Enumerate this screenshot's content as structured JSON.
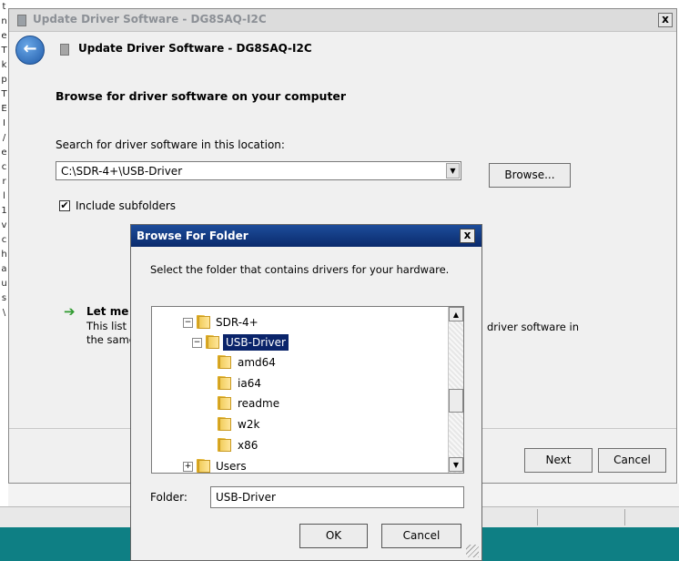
{
  "left_edge_chars": [
    "t",
    "n",
    "e",
    "T",
    "k",
    "p",
    "T",
    "E",
    "I",
    "/",
    "e",
    "c",
    "r",
    "l",
    "1",
    "",
    "v",
    "c",
    "h",
    "a",
    "u",
    "s",
    "\\"
  ],
  "wizard": {
    "title": "Update Driver Software - DG8SAQ-I2C",
    "close": "x",
    "back_arrow": "←",
    "header_title": "Update Driver Software - DG8SAQ-I2C",
    "heading": "Browse for driver software on your computer",
    "search_label": "Search for driver software in this location:",
    "path_value": "C:\\SDR-4+\\USB-Driver",
    "combo_arrow": "▼",
    "browse_label": "Browse...",
    "include_checked": "✔",
    "include_label": "Include subfolders",
    "let_me_arrow": "➔",
    "let_me_label": "Let me",
    "desc_line1": "This list v",
    "desc_line2": "the same",
    "desc_fragment": "driver software in",
    "next_label": "Next",
    "cancel_label": "Cancel"
  },
  "dialog": {
    "title": "Browse For Folder",
    "close": "x",
    "instruction": "Select the folder that contains drivers for your hardware.",
    "tree": {
      "items": [
        {
          "label": "SDR-4+",
          "expander": "−"
        },
        {
          "label": "USB-Driver",
          "expander": "−"
        },
        {
          "label": "amd64"
        },
        {
          "label": "ia64"
        },
        {
          "label": "readme"
        },
        {
          "label": "w2k"
        },
        {
          "label": "x86"
        },
        {
          "label": "Users",
          "expander": "+"
        }
      ],
      "scroll_up": "▲",
      "scroll_down": "▼"
    },
    "folder_label": "Folder:",
    "folder_value": "USB-Driver",
    "ok_label": "OK",
    "cancel_label": "Cancel"
  },
  "colors": {
    "dialog_title_bg": "#0a246a",
    "taskbar": "#0e7f84",
    "selection": "#0a246a"
  }
}
